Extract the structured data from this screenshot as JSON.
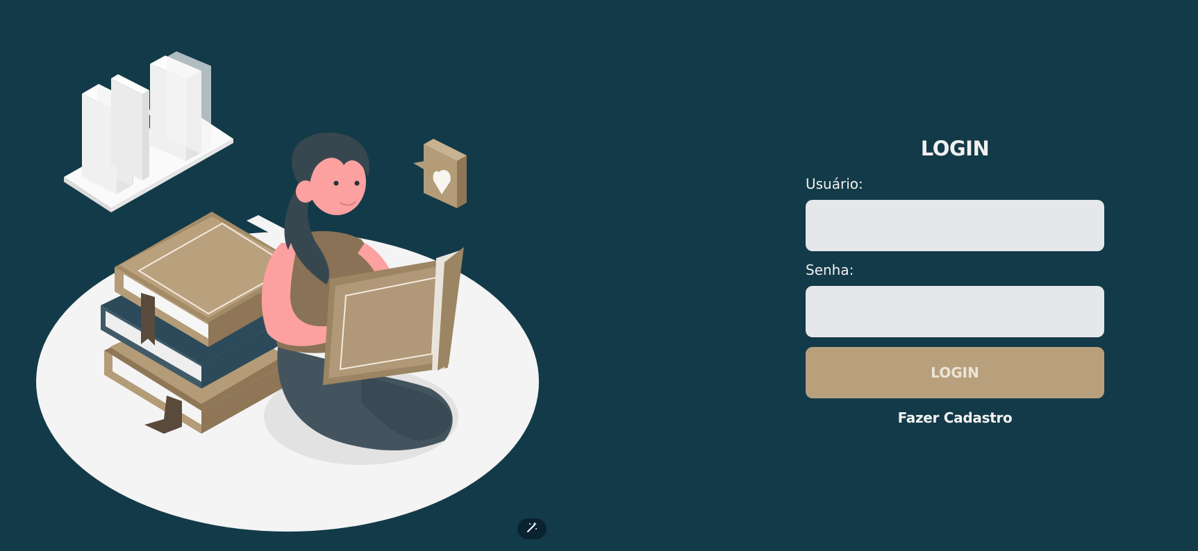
{
  "colors": {
    "background": "#133a48",
    "accent": "#b8a07d",
    "input_background": "#e6e7ea",
    "text": "#f1f1f1"
  },
  "illustration": {
    "subject": "woman-reading-book-illustration"
  },
  "login": {
    "title": "LOGIN",
    "username_label": "Usuário:",
    "username_value": "",
    "password_label": "Senha:",
    "password_value": "",
    "submit_label": "LOGIN",
    "signup_label": "Fazer Cadastro"
  },
  "floating_button": {
    "icon": "magic-wand-icon"
  }
}
